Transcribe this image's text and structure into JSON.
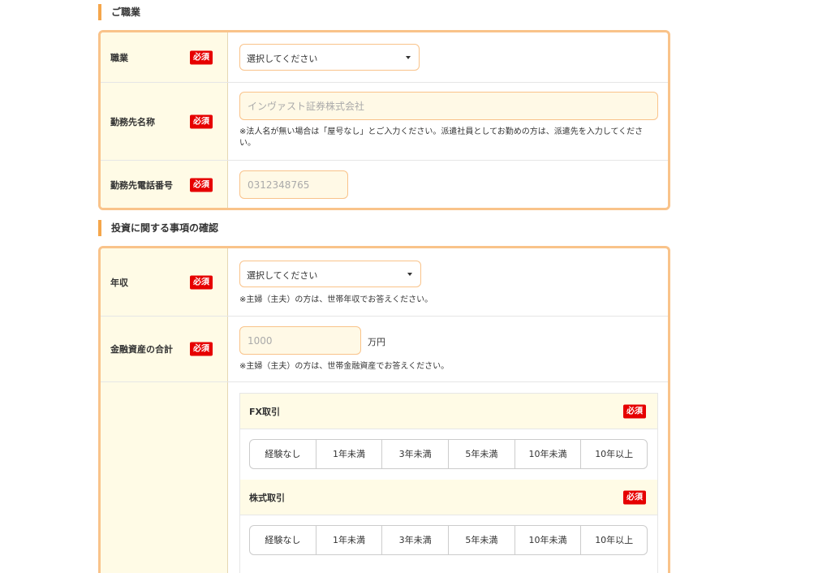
{
  "occupation_section": {
    "title": "ご職業",
    "rows": [
      {
        "label": "職業",
        "required": "必須",
        "select_value": "選択してください"
      },
      {
        "label": "勤務先名称",
        "required": "必須",
        "placeholder": "インヴァスト証券株式会社",
        "note": "※法人名が無い場合は「屋号なし」とご入力ください。派遣社員としてお勤めの方は、派遣先を入力してください。"
      },
      {
        "label": "勤務先電話番号",
        "required": "必須",
        "placeholder": "0312348765"
      }
    ]
  },
  "investment_section": {
    "title": "投資に関する事項の確認",
    "annual_income": {
      "label": "年収",
      "required": "必須",
      "select_value": "選択してください",
      "note": "※主婦（主夫）の方は、世帯年収でお答えください。"
    },
    "financial_assets": {
      "label": "金融資産の合計",
      "required": "必須",
      "placeholder": "1000",
      "unit": "万円",
      "note": "※主婦（主夫）の方は、世帯金融資産でお答えください。"
    },
    "experience": [
      {
        "title": "FX取引",
        "required": "必須",
        "options": [
          "経験なし",
          "1年未満",
          "3年未満",
          "5年未満",
          "10年未満",
          "10年以上"
        ]
      },
      {
        "title": "株式取引",
        "required": "必須",
        "options": [
          "経験なし",
          "1年未満",
          "3年未満",
          "5年未満",
          "10年未満",
          "10年以上"
        ]
      }
    ]
  },
  "colors": {
    "accent": "#f5a64b",
    "border": "#f9c38a",
    "label_bg": "#fffbe6",
    "required_badge": "#e60000"
  }
}
